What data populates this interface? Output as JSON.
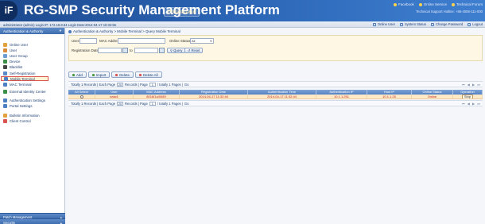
{
  "header": {
    "logo_text": "iF",
    "title": "RG-SMP Security Management Platform",
    "edition": "Professional",
    "links": [
      "Facebook",
      "Online Service",
      "Technical Forum"
    ],
    "support_line": "Technical Support Hotline: +86-4008-111-000"
  },
  "status_bar": {
    "login_info": "administrator (admin) Login IP: 172.18.8.64 Login Date:2014-04-17 10:32:55",
    "actions": [
      "Online User",
      "System Status",
      "Change Password",
      "Logout"
    ]
  },
  "sidebar": {
    "title": "Authentication & Authority",
    "items": [
      {
        "label": "Online User",
        "color": "#e2a13b"
      },
      {
        "label": "User",
        "color": "#d98a3a"
      },
      {
        "label": "User Group",
        "color": "#6e9bd3"
      },
      {
        "label": "Device",
        "color": "#3b8f46"
      },
      {
        "label": "Blacklist",
        "color": "#444444"
      },
      {
        "label": "Self-Registration",
        "color": "#5a8ac8"
      },
      {
        "label": "Mobile Terminal",
        "color": "#4d7fc3"
      },
      {
        "label": "MAC Terminal",
        "color": "#4d7fc3"
      },
      {
        "label": "External Identity Center",
        "color": "#3b8f46"
      },
      {
        "label": "Authentication Settings",
        "color": "#4d7fc3"
      },
      {
        "label": "Portal Settings",
        "color": "#4d7fc3"
      },
      {
        "label": "Bulletin Information",
        "color": "#e2a13b"
      },
      {
        "label": "Client Control",
        "color": "#d9534f"
      }
    ],
    "footer": [
      "Patch Management",
      "Security"
    ]
  },
  "breadcrumb": "Authentication & Authority > Mobile Terminal > Query Mobile Terminal",
  "query": {
    "user_label": "User:",
    "user_value": "",
    "mac_label": "MAC Address:",
    "mac_value": "",
    "status_label": "Online Status:",
    "status_value": "All",
    "reg_date_label": "Registration Date:",
    "to_label": "to",
    "query_btn": "Query",
    "reset_btn": "Reset"
  },
  "actions": [
    "Add",
    "Import",
    "Delete",
    "Delete All"
  ],
  "pager": {
    "text_1": "Totally 1 Records | Each Page",
    "per_page": "20",
    "text_2": "Records | Page",
    "page": "1",
    "text_3": "/ totally 1 Pages |",
    "go": "Go"
  },
  "grid": {
    "columns": [
      "All Select",
      "User",
      "MAC Address",
      "Registration Date",
      "Authentication Time",
      "Authentication IP",
      "Host IP",
      "Online Status",
      "Operation"
    ],
    "rows": [
      [
        "",
        "natw1",
        "8018/1a/0089",
        "2014-04-17 11:32:44",
        "2014-04-17 11:32:44",
        "10.1.1.251",
        "10.1.1.25",
        "Online",
        "Stop"
      ]
    ]
  }
}
